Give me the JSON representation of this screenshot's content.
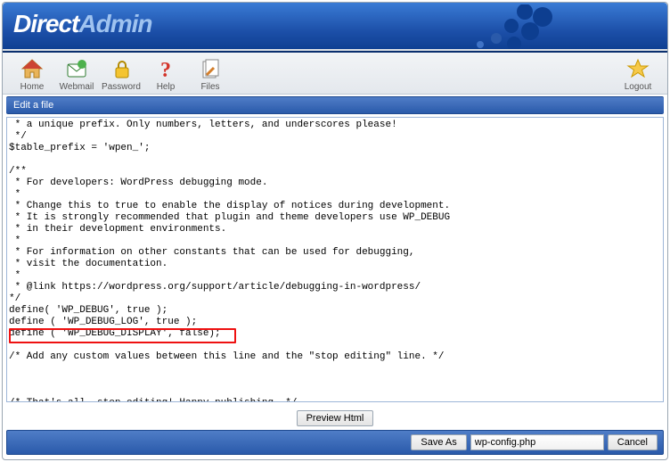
{
  "brand": {
    "name_plain": "Direct",
    "name_accent": "Admin"
  },
  "toolbar": {
    "items": [
      {
        "label": "Home"
      },
      {
        "label": "Webmail"
      },
      {
        "label": "Password"
      },
      {
        "label": "Help"
      },
      {
        "label": "Files"
      }
    ],
    "logout": {
      "label": "Logout"
    }
  },
  "section_title": "Edit a file",
  "editor_content": " * a unique prefix. Only numbers, letters, and underscores please!\n */\n$table_prefix = 'wpen_';\n\n/**\n * For developers: WordPress debugging mode.\n *\n * Change this to true to enable the display of notices during development.\n * It is strongly recommended that plugin and theme developers use WP_DEBUG\n * in their development environments.\n *\n * For information on other constants that can be used for debugging,\n * visit the documentation.\n *\n * @link https://wordpress.org/support/article/debugging-in-wordpress/\n*/\ndefine( 'WP_DEBUG', true );\ndefine ( 'WP_DEBUG_LOG', true );\ndefine ( 'WP_DEBUG_DISPLAY', false);\n\n/* Add any custom values between this line and the \"stop editing\" line. */\n\n\n\n/* That's all, stop editing! Happy publishing. */\n",
  "buttons": {
    "preview": "Preview Html",
    "save_as": "Save As",
    "cancel": "Cancel"
  },
  "filename": "wp-config.php"
}
